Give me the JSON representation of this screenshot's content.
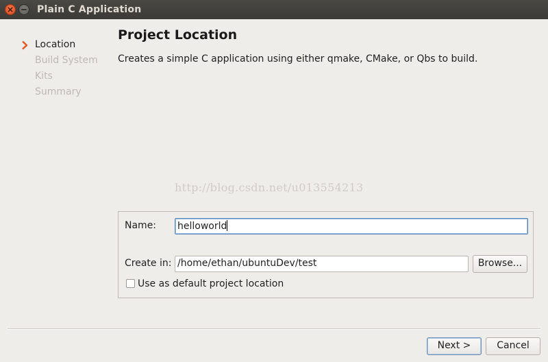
{
  "window": {
    "title": "Plain C Application",
    "close_icon": "close-icon",
    "minimize_icon": "minimize-icon"
  },
  "sidebar": {
    "items": [
      {
        "label": "Location",
        "active": true
      },
      {
        "label": "Build System",
        "active": false
      },
      {
        "label": "Kits",
        "active": false
      },
      {
        "label": "Summary",
        "active": false
      }
    ],
    "active_icon": "chevron-right-icon",
    "active_color": "#e95420"
  },
  "page": {
    "heading": "Project Location",
    "description": "Creates a simple C application using either qmake, CMake, or Qbs to build.",
    "watermark": "http://blog.csdn.net/u013554213"
  },
  "form": {
    "name_label": "Name:",
    "name_value": "helloworld",
    "create_in_label": "Create in:",
    "create_in_value": "/home/ethan/ubuntuDev/test",
    "browse_label": "Browse...",
    "default_location_label": "Use as default project location",
    "default_location_checked": false
  },
  "footer": {
    "next_label": "Next >",
    "cancel_label": "Cancel"
  }
}
